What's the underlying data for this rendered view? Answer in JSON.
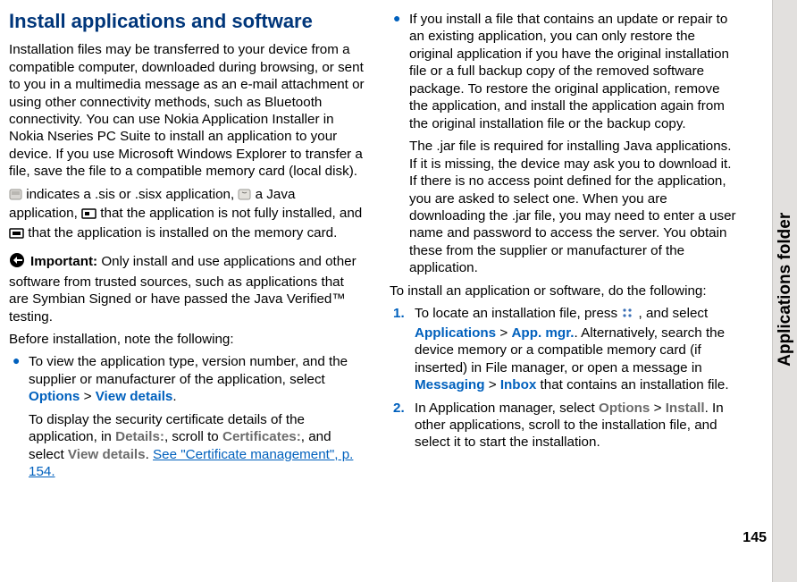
{
  "sidebar_label": "Applications folder",
  "page_number": "145",
  "heading": "Install applications and software",
  "intro": "Installation files may be transferred to your device from a compatible computer, downloaded during browsing, or sent to you in a multimedia message as an e-mail attachment or using other connectivity methods, such as Bluetooth connectivity. You can use Nokia Application Installer in Nokia Nseries PC Suite to install an application to your device. If you use Microsoft Windows Explorer to transfer a file, save the file to a compatible memory card (local disk).",
  "icons_para": {
    "t1": " indicates a .sis or .sisx application, ",
    "t2": " a Java application, ",
    "t3": " that the application is not fully installed, and ",
    "t4": " that the application is installed on the memory card."
  },
  "important_label": "Important:",
  "important_text": "  Only install and use applications and other software from trusted sources, such as applications that are Symbian Signed or have passed the Java Verified™ testing.",
  "before_install": "Before installation, note the following:",
  "bullets_col1": {
    "b1a": "To view the application type, version number, and the supplier or manufacturer of the application, select ",
    "options": "Options",
    "gt": " > ",
    "viewdetails": " View details",
    "b1end": ".",
    "b1p2a": "To display the security certificate details of the application, in ",
    "details": "Details:",
    "b1p2b": ", scroll to ",
    "certs": "Certificates:",
    "b1p2c": ", and select ",
    "viewdetails2": "View details",
    "b1p2d": ". ",
    "link_text": "See \"Certificate management\", p. 154."
  },
  "bullets_col2": {
    "b2": "If you install a file that contains an update or repair to an existing application, you can only restore the original application if you have the original installation file or a full backup copy of the removed software package. To restore the original application, remove the application, and install the application again from the original installation file or the backup copy.",
    "b2p2": "The .jar file is required for installing Java applications. If it is missing, the device may ask you to download it. If there is no access point defined for the application, you are asked to select one. When you are downloading the .jar file, you may need to enter a user name and password to access the server. You obtain these from the supplier or manufacturer of the application."
  },
  "to_install": "To install an application or software, do the following:",
  "steps": {
    "s1a": "To locate an installation file, press ",
    "s1b": " , and select ",
    "applications": "Applications",
    "appmgr": " App. mgr.",
    "s1c": ". Alternatively, search the device memory or a compatible memory card (if inserted) in File manager, or open a message in ",
    "messaging": "Messaging",
    "inbox": " Inbox",
    "s1d": " that contains an installation file.",
    "s2a": "In Application manager, select ",
    "install": "Install",
    "s2b": ". In other applications, scroll to the installation file, and select it to start the installation."
  }
}
